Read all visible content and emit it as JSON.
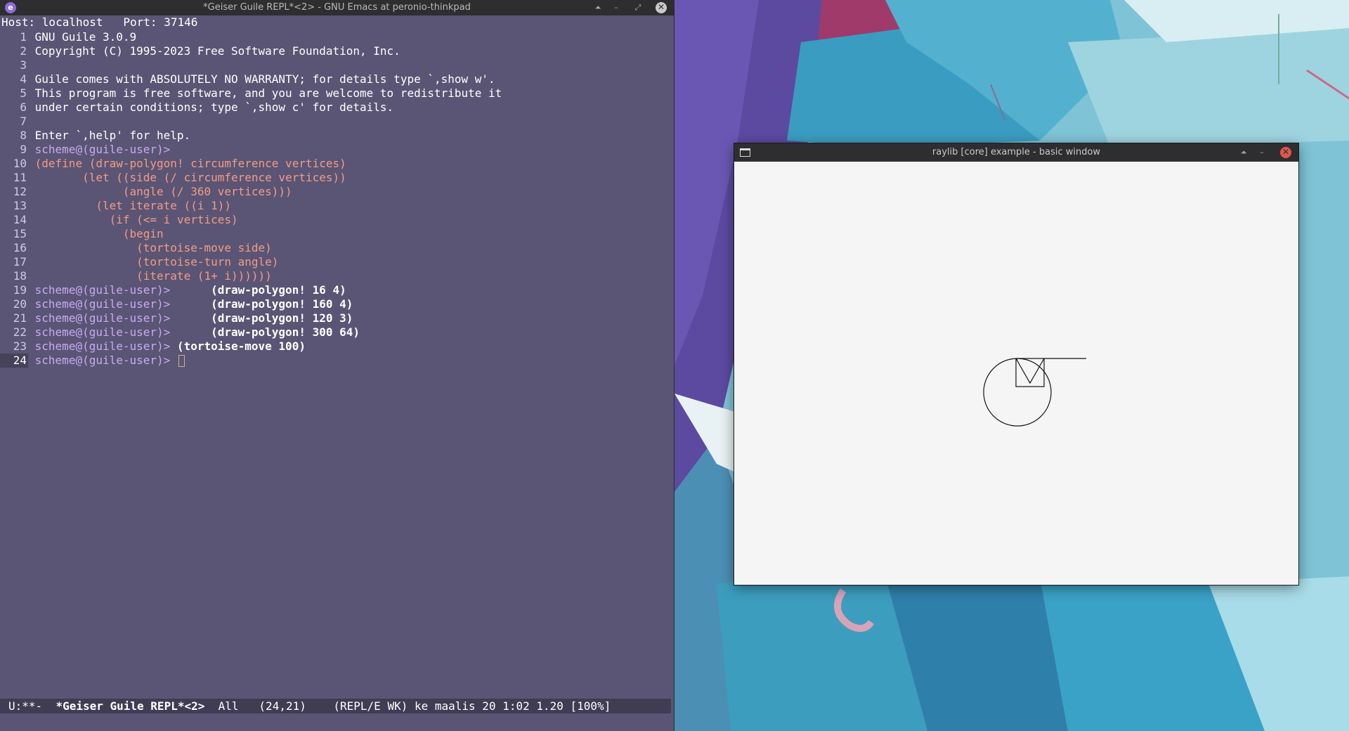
{
  "emacs": {
    "title": "*Geiser Guile REPL*<2> - GNU Emacs at peronio-thinkpad",
    "app_icon": "emacs-icon",
    "controls": {
      "keep_above": "⏶",
      "minimize": "–",
      "maximize": "⤢",
      "close": "✕"
    },
    "host_line": "Host: localhost   Port: 37146",
    "lines": [
      {
        "n": "1",
        "segments": [
          {
            "cls": "tx",
            "text": "GNU Guile 3.0.9"
          }
        ]
      },
      {
        "n": "2",
        "segments": [
          {
            "cls": "tx",
            "text": "Copyright (C) 1995-2023 Free Software Foundation, Inc."
          }
        ]
      },
      {
        "n": "3",
        "segments": []
      },
      {
        "n": "4",
        "segments": [
          {
            "cls": "tx",
            "text": "Guile comes with ABSOLUTELY NO WARRANTY; for details type `,show w'."
          }
        ]
      },
      {
        "n": "5",
        "segments": [
          {
            "cls": "tx",
            "text": "This program is free software, and you are welcome to redistribute it"
          }
        ]
      },
      {
        "n": "6",
        "segments": [
          {
            "cls": "tx",
            "text": "under certain conditions; type `,show c' for details."
          }
        ]
      },
      {
        "n": "7",
        "segments": []
      },
      {
        "n": "8",
        "segments": [
          {
            "cls": "tx",
            "text": "Enter `,help' for help."
          }
        ]
      },
      {
        "n": "9",
        "segments": [
          {
            "cls": "prompt",
            "text": "scheme@(guile-user)>"
          }
        ]
      },
      {
        "n": "10",
        "segments": [
          {
            "cls": "code",
            "text": "(define (draw-polygon! circumference vertices)"
          }
        ]
      },
      {
        "n": "11",
        "segments": [
          {
            "cls": "code",
            "text": "       (let ((side (/ circumference vertices))"
          }
        ]
      },
      {
        "n": "12",
        "segments": [
          {
            "cls": "code",
            "text": "             (angle (/ 360 vertices)))"
          }
        ]
      },
      {
        "n": "13",
        "segments": [
          {
            "cls": "code",
            "text": "         (let iterate ((i 1))"
          }
        ]
      },
      {
        "n": "14",
        "segments": [
          {
            "cls": "code",
            "text": "           (if (<= i vertices)"
          }
        ]
      },
      {
        "n": "15",
        "segments": [
          {
            "cls": "code",
            "text": "             (begin"
          }
        ]
      },
      {
        "n": "16",
        "segments": [
          {
            "cls": "code",
            "text": "               (tortoise-move side)"
          }
        ]
      },
      {
        "n": "17",
        "segments": [
          {
            "cls": "code",
            "text": "               (tortoise-turn angle)"
          }
        ]
      },
      {
        "n": "18",
        "segments": [
          {
            "cls": "code",
            "text": "               (iterate (1+ i))))))"
          }
        ]
      },
      {
        "n": "19",
        "segments": [
          {
            "cls": "prompt",
            "text": "scheme@(guile-user)>"
          },
          {
            "cls": "input",
            "text": "      (draw-polygon! 16 4)"
          }
        ]
      },
      {
        "n": "20",
        "segments": [
          {
            "cls": "prompt",
            "text": "scheme@(guile-user)>"
          },
          {
            "cls": "input",
            "text": "      (draw-polygon! 160 4)"
          }
        ]
      },
      {
        "n": "21",
        "segments": [
          {
            "cls": "prompt",
            "text": "scheme@(guile-user)>"
          },
          {
            "cls": "input",
            "text": "      (draw-polygon! 120 3)"
          }
        ]
      },
      {
        "n": "22",
        "segments": [
          {
            "cls": "prompt",
            "text": "scheme@(guile-user)>"
          },
          {
            "cls": "input",
            "text": "      (draw-polygon! 300 64)"
          }
        ]
      },
      {
        "n": "23",
        "segments": [
          {
            "cls": "prompt",
            "text": "scheme@(guile-user)>"
          },
          {
            "cls": "input",
            "text": " (tortoise-move 100)"
          }
        ]
      },
      {
        "n": "24",
        "current": true,
        "segments": [
          {
            "cls": "prompt",
            "text": "scheme@(guile-user)>"
          },
          {
            "cls": "input",
            "text": " "
          }
        ]
      }
    ],
    "modeline": {
      "status": "U:**-  ",
      "buffer": "*Geiser Guile REPL*<2>",
      "rest": "  All   (24,21)    (REPL/E WK) ke maalis 20 1:02 1.20 [100%]"
    }
  },
  "raylib": {
    "title": "raylib [core] example - basic window",
    "window_icon": "window-icon",
    "controls": {
      "keep_above": "⏶",
      "minimize": "–",
      "close": "✕"
    }
  }
}
